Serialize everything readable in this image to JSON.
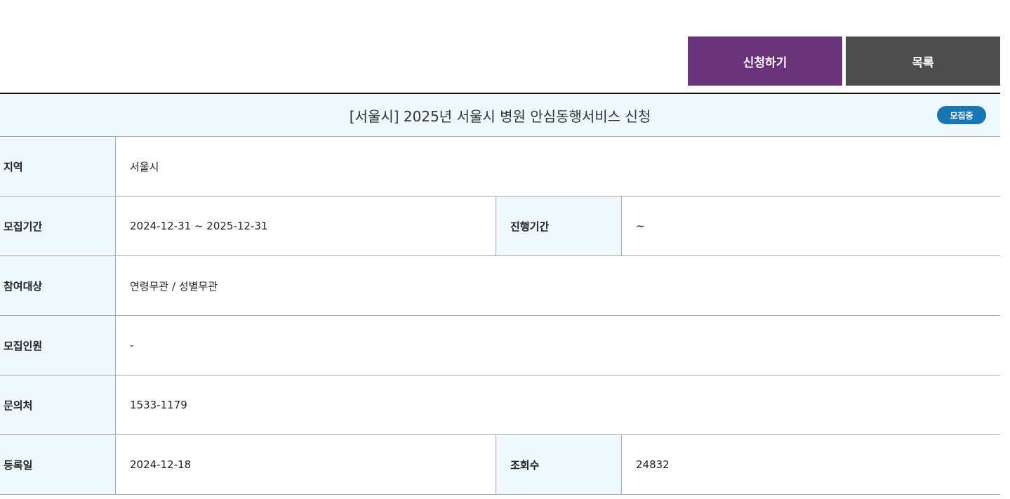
{
  "buttons": {
    "apply": "신청하기",
    "list": "목록"
  },
  "title": "[서울시] 2025년 서울시 병원 안심동행서비스 신청",
  "status_badge": "모집중",
  "colors": {
    "apply_bg": "#6b347a",
    "list_bg": "#4d4d4d",
    "badge_bg": "#1776b3",
    "label_bg": "#eef8fd"
  },
  "fields": {
    "region": {
      "label": "지역",
      "value": "서울시"
    },
    "recruit_period": {
      "label": "모집기간",
      "value": "2024-12-31 ~ 2025-12-31"
    },
    "progress_period": {
      "label": "진행기간",
      "value": "~"
    },
    "target": {
      "label": "참여대상",
      "value": "연령무관 / 성별무관"
    },
    "headcount": {
      "label": "모집인원",
      "value": "-"
    },
    "contact": {
      "label": "문의처",
      "value": "1533-1179"
    },
    "reg_date": {
      "label": "등록일",
      "value": "2024-12-18"
    },
    "views": {
      "label": "조회수",
      "value": "24832"
    }
  }
}
